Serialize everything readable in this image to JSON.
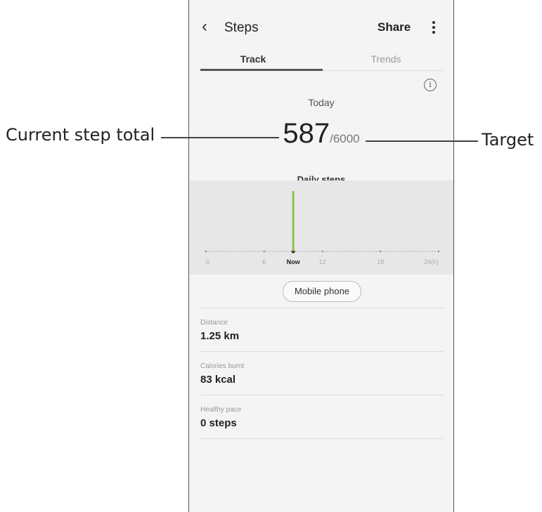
{
  "header": {
    "back_icon": "chevron-left-icon",
    "title": "Steps",
    "share_label": "Share",
    "more_icon": "more-vertical-icon"
  },
  "tabs": [
    {
      "label": "Track",
      "selected": true
    },
    {
      "label": "Trends",
      "selected": false
    }
  ],
  "info_icon": "i",
  "summary": {
    "period": "Today",
    "current_steps": "587",
    "target": "/6000",
    "caption": "Daily steps"
  },
  "chart_data": {
    "type": "bar",
    "x_ticks": [
      "0",
      "6",
      "Now",
      "12",
      "18",
      "24(h)"
    ],
    "xlim": [
      0,
      24
    ],
    "now_hour": 9,
    "bars": [
      {
        "hour": 9,
        "steps": 587
      }
    ],
    "bar_color": "#8bc34a"
  },
  "device_button": "Mobile phone",
  "stats": [
    {
      "label": "Distance",
      "value": "1.25 km"
    },
    {
      "label": "Calories burnt",
      "value": "83 kcal"
    },
    {
      "label": "Healthy pace",
      "value": "0 steps"
    }
  ],
  "annotations": {
    "left": "Current step total",
    "right": "Target"
  }
}
